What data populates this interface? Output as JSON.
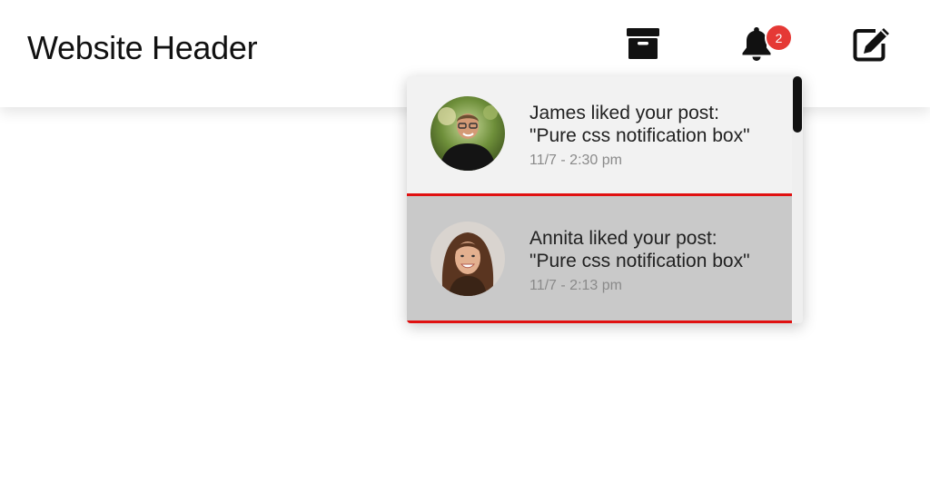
{
  "header": {
    "title": "Website Header",
    "icons": {
      "archive": "archive-icon",
      "notifications": "bell-icon",
      "compose": "edit-icon"
    },
    "notification_count": "2",
    "badge_color": "#e53935"
  },
  "notifications": [
    {
      "line1": "James liked your post:",
      "line2": "\"Pure css notification box\"",
      "time": "11/7 - 2:30 pm",
      "background": "#f2f2f2"
    },
    {
      "line1": "Annita liked your post:",
      "line2": "\"Pure css notification box\"",
      "time": "11/7 - 2:13 pm",
      "background": "#c9c9c9"
    }
  ],
  "colors": {
    "divider": "#e01010",
    "text": "#222222",
    "time_text": "#8a8a8a"
  }
}
